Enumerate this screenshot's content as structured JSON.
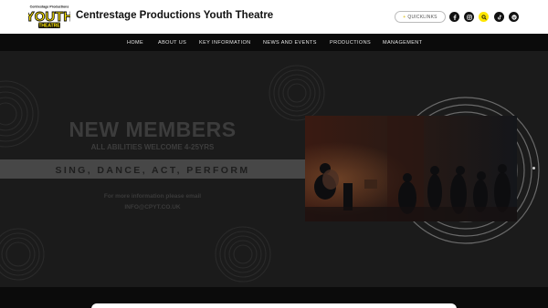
{
  "header": {
    "logo_top_text": "Centrestage Productions",
    "logo_main_text": "YOUTH",
    "logo_sub_text": "THEATRE",
    "title": "Centrestage Productions Youth Theatre",
    "quicklinks_label": "QUICKLINKS",
    "quicklinks_prefix": "+",
    "social_icons": [
      "facebook-icon",
      "instagram-icon",
      "search-icon",
      "tiktok-icon",
      "spotify-icon"
    ]
  },
  "nav": {
    "items": [
      "HOME",
      "ABOUT US",
      "KEY INFORMATION",
      "NEWS AND EVENTS",
      "PRODUCTIONS",
      "MANAGEMENT"
    ]
  },
  "hero": {
    "headline": "NEW MEMBERS",
    "subhead": "ALL ABILITIES WELCOME 4-25YRS",
    "tagline": "SING, DANCE, ACT, PERFORM",
    "info_line": "For more information please email",
    "email": "INFO@CPYT.CO.UK"
  },
  "colors": {
    "brand_yellow": "#ffe600",
    "header_bg": "#ffffff",
    "nav_bg": "#0b0b0b",
    "hero_bg": "#1b1b1b"
  }
}
